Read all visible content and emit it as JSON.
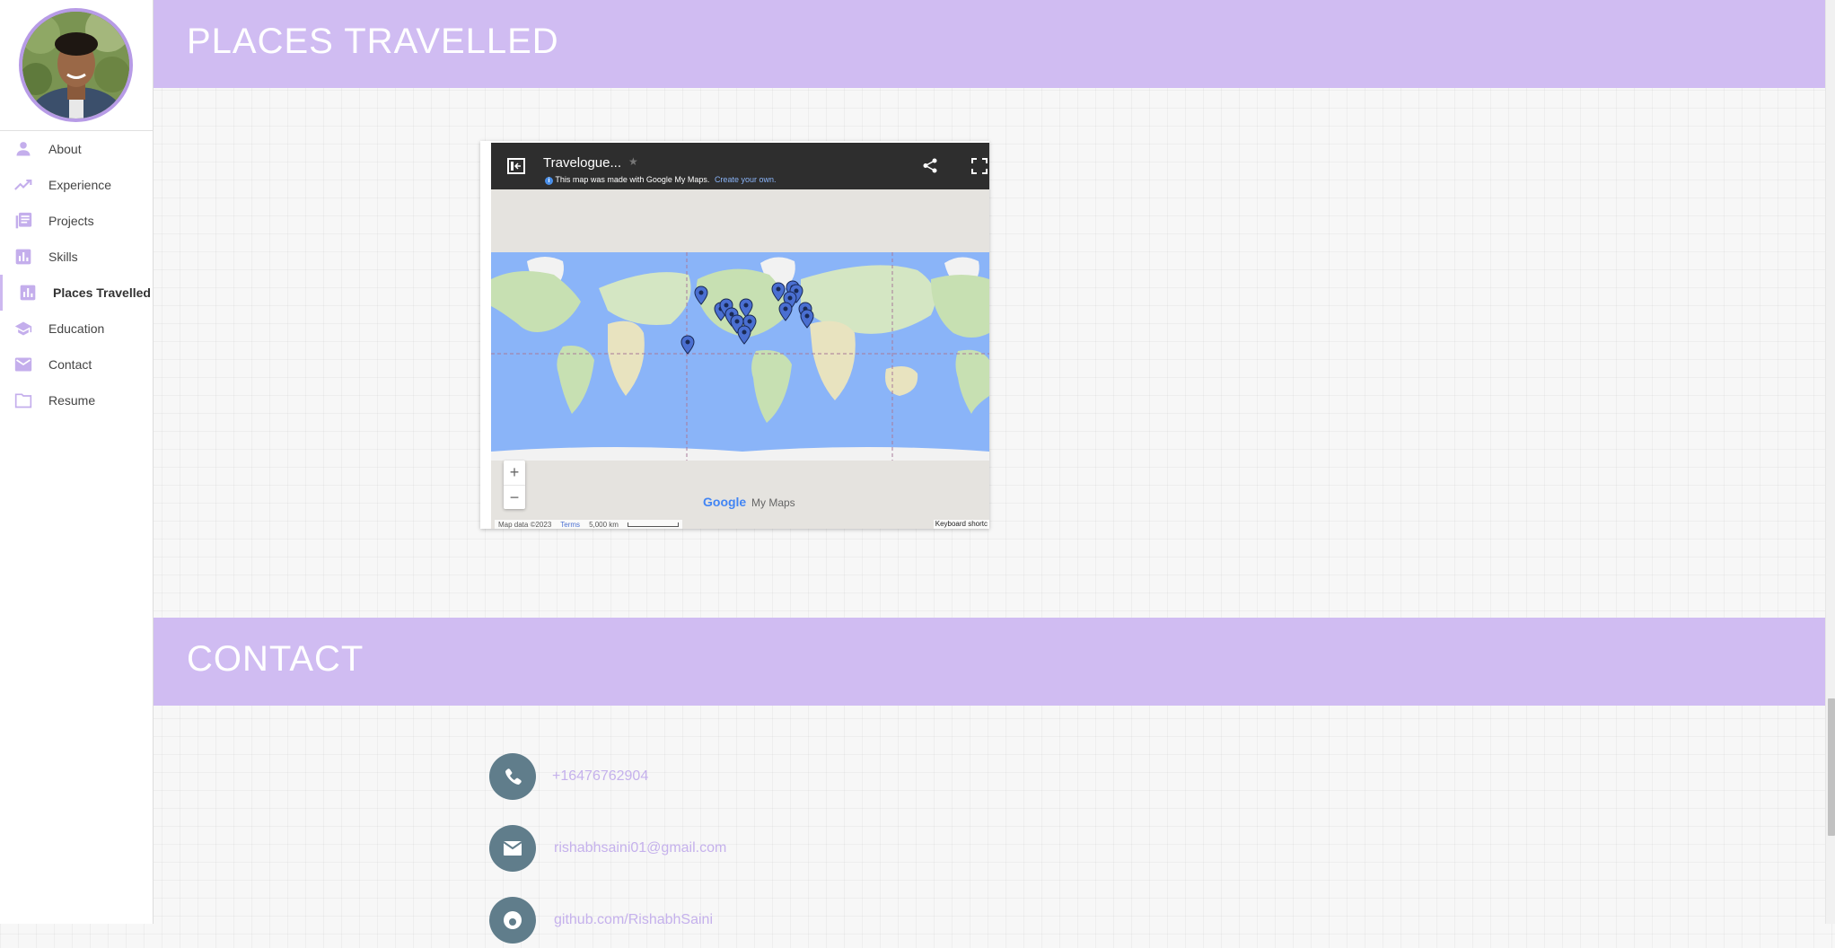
{
  "sidebar": {
    "items": [
      {
        "label": "About",
        "icon": "person-icon"
      },
      {
        "label": "Experience",
        "icon": "trending-up-icon"
      },
      {
        "label": "Projects",
        "icon": "article-icon"
      },
      {
        "label": "Skills",
        "icon": "bar-chart-icon"
      },
      {
        "label": "Places Travelled",
        "icon": "bar-chart-icon",
        "active": true
      },
      {
        "label": "Education",
        "icon": "school-icon"
      },
      {
        "label": "Contact",
        "icon": "mail-icon"
      },
      {
        "label": "Resume",
        "icon": "folder-icon"
      }
    ]
  },
  "sections": {
    "places_title": "PLACES TRAVELLED",
    "contact_title": "CONTACT"
  },
  "map": {
    "title": "Travelogue...",
    "notice": "This map was made with Google My Maps.",
    "notice_link": "Create your own.",
    "zoom_in": "+",
    "zoom_out": "−",
    "brand_google": "Google",
    "brand_mymaps": "My Maps",
    "map_data": "Map data ©2023",
    "terms": "Terms",
    "scale": "5,000 km",
    "keyboard": "Keyboard shortc"
  },
  "contact": {
    "phone": "+16476762904",
    "email": "rishabhsaini01@gmail.com",
    "github": "github.com/RishabhSaini"
  },
  "colors": {
    "accent": "#d0bcf2",
    "avatar_border": "#b79be6",
    "icon": "#c4aeec",
    "contact_circle": "#607d8b",
    "contact_text": "#c5b1ec",
    "map_pin": "#4a6fd1"
  }
}
